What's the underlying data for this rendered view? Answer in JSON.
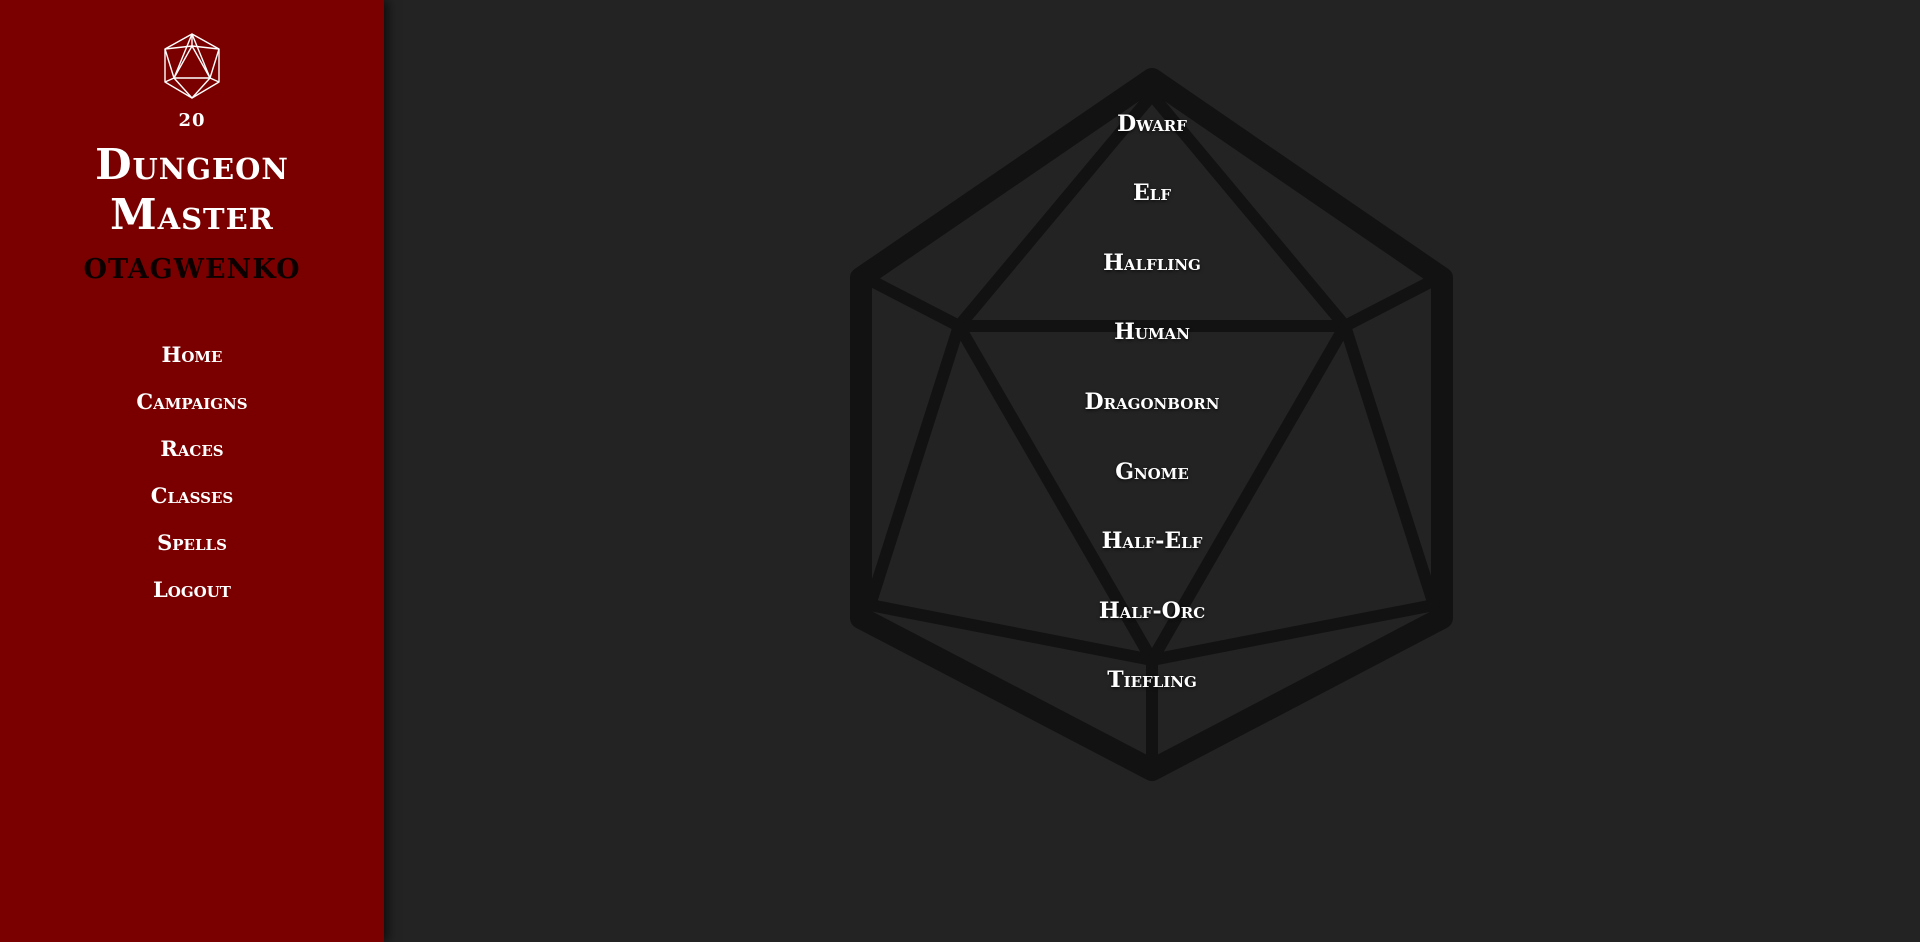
{
  "sidebar": {
    "logo_icon": "d20-icon",
    "logo_number": "20",
    "brand_line1": "Dungeon",
    "brand_line2": "Master",
    "username": "otagwenko",
    "nav": [
      {
        "label": "Home"
      },
      {
        "label": "Campaigns"
      },
      {
        "label": "Races"
      },
      {
        "label": "Classes"
      },
      {
        "label": "Spells"
      },
      {
        "label": "Logout"
      }
    ]
  },
  "main": {
    "background_icon": "d20-icon",
    "races": [
      {
        "label": "Dwarf"
      },
      {
        "label": "Elf"
      },
      {
        "label": "Halfling"
      },
      {
        "label": "Human"
      },
      {
        "label": "Dragonborn"
      },
      {
        "label": "Gnome"
      },
      {
        "label": "Half-Elf"
      },
      {
        "label": "Half-Orc"
      },
      {
        "label": "Tiefling"
      }
    ]
  },
  "colors": {
    "sidebar_bg": "#7a0000",
    "main_bg": "#232323",
    "d20_stroke": "#111111"
  }
}
